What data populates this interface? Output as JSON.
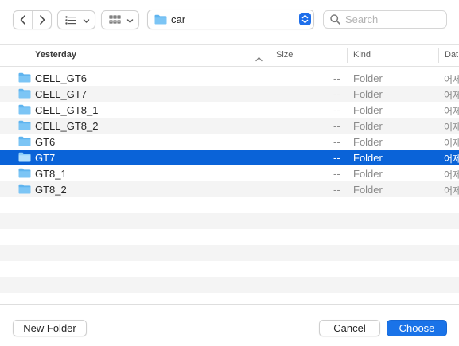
{
  "toolbar": {
    "location": "car",
    "search_placeholder": "Search"
  },
  "columns": {
    "name": "Yesterday",
    "size": "Size",
    "kind": "Kind",
    "date": "Dat"
  },
  "files": [
    {
      "name": "CELL_GT6",
      "size": "--",
      "kind": "Folder",
      "date": "어제"
    },
    {
      "name": "CELL_GT7",
      "size": "--",
      "kind": "Folder",
      "date": "어제"
    },
    {
      "name": "CELL_GT8_1",
      "size": "--",
      "kind": "Folder",
      "date": "어제"
    },
    {
      "name": "CELL_GT8_2",
      "size": "--",
      "kind": "Folder",
      "date": "어제"
    },
    {
      "name": "GT6",
      "size": "--",
      "kind": "Folder",
      "date": "어제"
    },
    {
      "name": "GT7",
      "size": "--",
      "kind": "Folder",
      "date": "어제",
      "selected": true
    },
    {
      "name": "GT8_1",
      "size": "--",
      "kind": "Folder",
      "date": "어제"
    },
    {
      "name": "GT8_2",
      "size": "--",
      "kind": "Folder",
      "date": "어제"
    }
  ],
  "footer": {
    "new_folder": "New Folder",
    "cancel": "Cancel",
    "choose": "Choose"
  },
  "colors": {
    "accent": "#1a73e8",
    "selection": "#0a63d8",
    "folder": "#5fb4ef"
  }
}
